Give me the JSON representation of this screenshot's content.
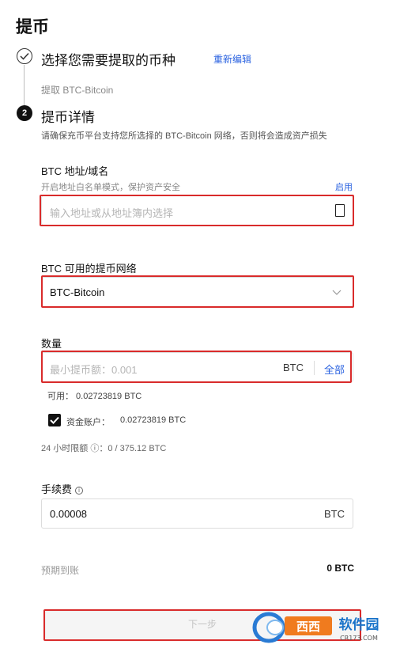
{
  "page": {
    "title": "提币"
  },
  "step1": {
    "title": "选择您需要提取的币种",
    "reedit_label": "重新编辑",
    "subtitle": "提取 BTC-Bitcoin"
  },
  "step2": {
    "number": "2",
    "title": "提币详情",
    "notice": "请确保充币平台支持您所选择的 BTC-Bitcoin 网络，否则将会造成资产损失"
  },
  "address": {
    "label": "BTC 地址/域名",
    "hint": "开启地址白名单模式，保护资产安全",
    "enable_label": "启用",
    "placeholder": "输入地址或从地址簿内选择"
  },
  "network": {
    "label": "BTC 可用的提币网络",
    "selected": "BTC-Bitcoin"
  },
  "amount": {
    "label": "数量",
    "placeholder": "最小提币额：0.001",
    "unit": "BTC",
    "all_label": "全部",
    "available": "可用： 0.02723819 BTC",
    "funding_account_label": "资金账户：",
    "funding_account_value": "0.02723819 BTC",
    "limit": "24 小时限额 ⓘ：0 / 375.12 BTC"
  },
  "fee": {
    "label": "手续费",
    "value": "0.00008",
    "unit": "BTC"
  },
  "expected": {
    "label": "预期到账",
    "value": "0 BTC"
  },
  "next_button": "下一步",
  "watermark": {
    "brand": "西西软件园",
    "url": "CR173.COM"
  }
}
